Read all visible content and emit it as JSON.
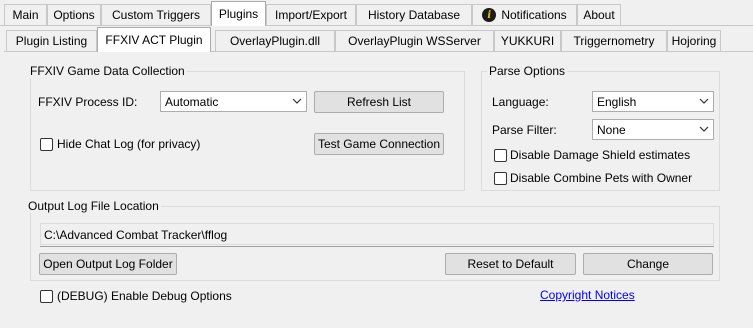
{
  "top_tabs": [
    {
      "label": "Main"
    },
    {
      "label": "Options"
    },
    {
      "label": "Custom Triggers"
    },
    {
      "label": "Plugins"
    },
    {
      "label": "Import/Export"
    },
    {
      "label": "History Database"
    },
    {
      "label": "Notifications"
    },
    {
      "label": "About"
    }
  ],
  "plugin_tabs": [
    {
      "label": "Plugin Listing"
    },
    {
      "label": "FFXIV ACT Plugin"
    },
    {
      "label": "OverlayPlugin.dll"
    },
    {
      "label": "OverlayPlugin WSServer"
    },
    {
      "label": "YUKKURI"
    },
    {
      "label": "Triggernometry"
    },
    {
      "label": "Hojoring"
    }
  ],
  "game_data": {
    "title": "FFXIV Game Data Collection",
    "process_id_label": "FFXIV Process ID:",
    "process_id_value": "Automatic",
    "refresh_button": "Refresh List",
    "hide_chat_label": "Hide Chat Log (for privacy)",
    "test_connection_button": "Test Game Connection"
  },
  "parse_options": {
    "title": "Parse Options",
    "language_label": "Language:",
    "language_value": "English",
    "filter_label": "Parse Filter:",
    "filter_value": "None",
    "disable_shield_label": "Disable Damage Shield estimates",
    "disable_combine_label": "Disable Combine Pets with Owner"
  },
  "output_log": {
    "title": "Output Log File Location",
    "path": "C:\\Advanced Combat Tracker\\fflog",
    "open_folder_button": "Open Output Log Folder",
    "reset_button": "Reset to Default",
    "change_button": "Change"
  },
  "debug_label": "(DEBUG) Enable Debug Options",
  "copyright_link": "Copyright Notices",
  "colors": {
    "background": "#f0f0f0",
    "link": "#0000ff",
    "button_face": "#e1e1e1"
  }
}
